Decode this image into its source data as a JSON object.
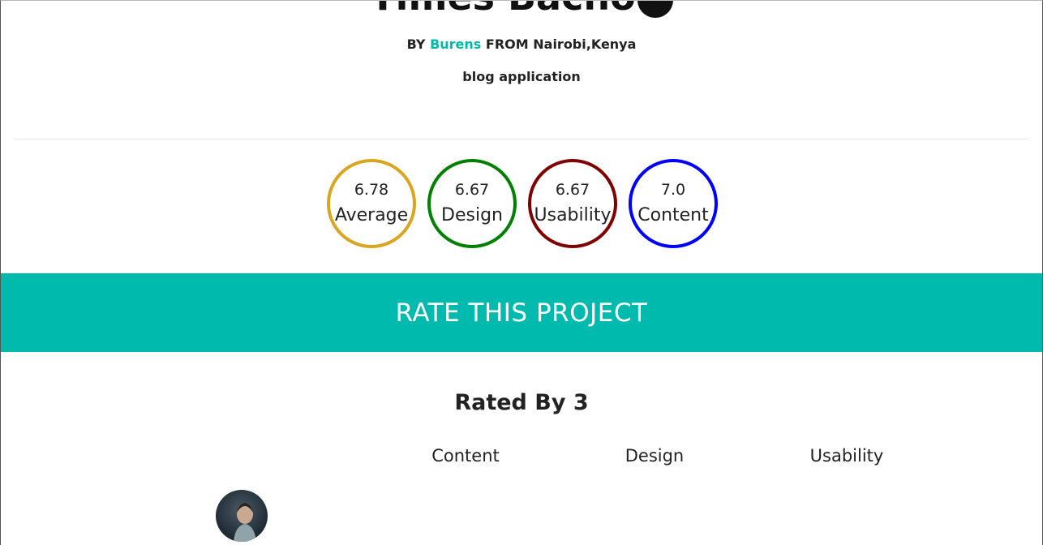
{
  "header": {
    "title": "Times Bacho",
    "byline_prefix": "BY",
    "author": "Burens",
    "byline_from": "FROM Nairobi,Kenya",
    "description": "blog application"
  },
  "scores": [
    {
      "value": "6.78",
      "label": "Average",
      "color": "#DAA520"
    },
    {
      "value": "6.67",
      "label": "Design",
      "color": "#008000"
    },
    {
      "value": "6.67",
      "label": "Usability",
      "color": "#800000"
    },
    {
      "value": "7.0",
      "label": "Content",
      "color": "#0000FF"
    }
  ],
  "rate_banner": {
    "label": "RATE THIS PROJECT",
    "color": "#00BBAD"
  },
  "ratings": {
    "title": "Rated By 3",
    "columns": [
      "Content",
      "Design",
      "Usability"
    ]
  }
}
